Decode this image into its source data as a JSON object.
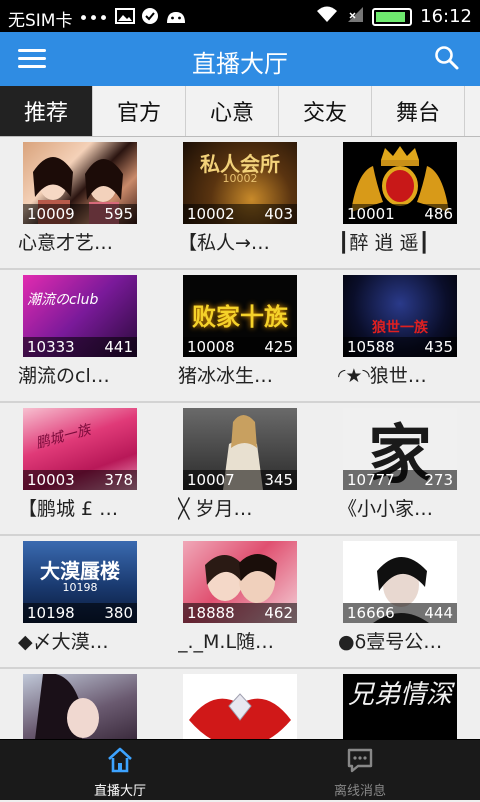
{
  "status_bar": {
    "carrier": "无SIM卡",
    "dots": "•••",
    "time": "16:12",
    "battery_level": 0.8
  },
  "app_bar": {
    "title": "直播大厅"
  },
  "tabs": [
    {
      "label": "推荐",
      "active": true
    },
    {
      "label": "官方",
      "active": false
    },
    {
      "label": "心意",
      "active": false
    },
    {
      "label": "交友",
      "active": false
    },
    {
      "label": "舞台",
      "active": false
    }
  ],
  "rooms": [
    {
      "id": "10009",
      "count": "595",
      "title": "心意才艺…"
    },
    {
      "id": "10002",
      "count": "403",
      "title": "【私人→…",
      "thumb_text": "私人会所",
      "thumb_sub": "10002"
    },
    {
      "id": "10001",
      "count": "486",
      "title": "┃醉 逍 遥┃"
    },
    {
      "id": "10333",
      "count": "441",
      "title": "潮流のcl…",
      "thumb_text": "潮流のclub"
    },
    {
      "id": "10008",
      "count": "425",
      "title": "猪冰冰生…",
      "thumb_text": "败家十族"
    },
    {
      "id": "10588",
      "count": "435",
      "title": "◜★◝狼世…",
      "thumb_text": "狼世一族"
    },
    {
      "id": "10003",
      "count": "378",
      "title": "【鹏城 £ …",
      "thumb_text": "鹏城一族"
    },
    {
      "id": "10007",
      "count": "345",
      "title": "╳ 岁月…"
    },
    {
      "id": "10777",
      "count": "273",
      "title": "《小小家…",
      "thumb_text": "家"
    },
    {
      "id": "10198",
      "count": "380",
      "title": "◆〆大漠…",
      "thumb_text": "大漠蜃楼",
      "thumb_sub": "10198"
    },
    {
      "id": "18888",
      "count": "462",
      "title": "_._M.L随…"
    },
    {
      "id": "16666",
      "count": "444",
      "title": "●δ壹号公…"
    },
    {
      "id": "",
      "count": "",
      "title": ""
    },
    {
      "id": "",
      "count": "",
      "title": ""
    },
    {
      "id": "",
      "count": "",
      "title": "",
      "thumb_text": "兄弟情深"
    }
  ],
  "bottom_nav": [
    {
      "label": "直播大厅",
      "active": true
    },
    {
      "label": "离线消息",
      "active": false
    }
  ],
  "colors": {
    "accent": "#2f8ce3",
    "active_nav": "#3da3ff"
  }
}
